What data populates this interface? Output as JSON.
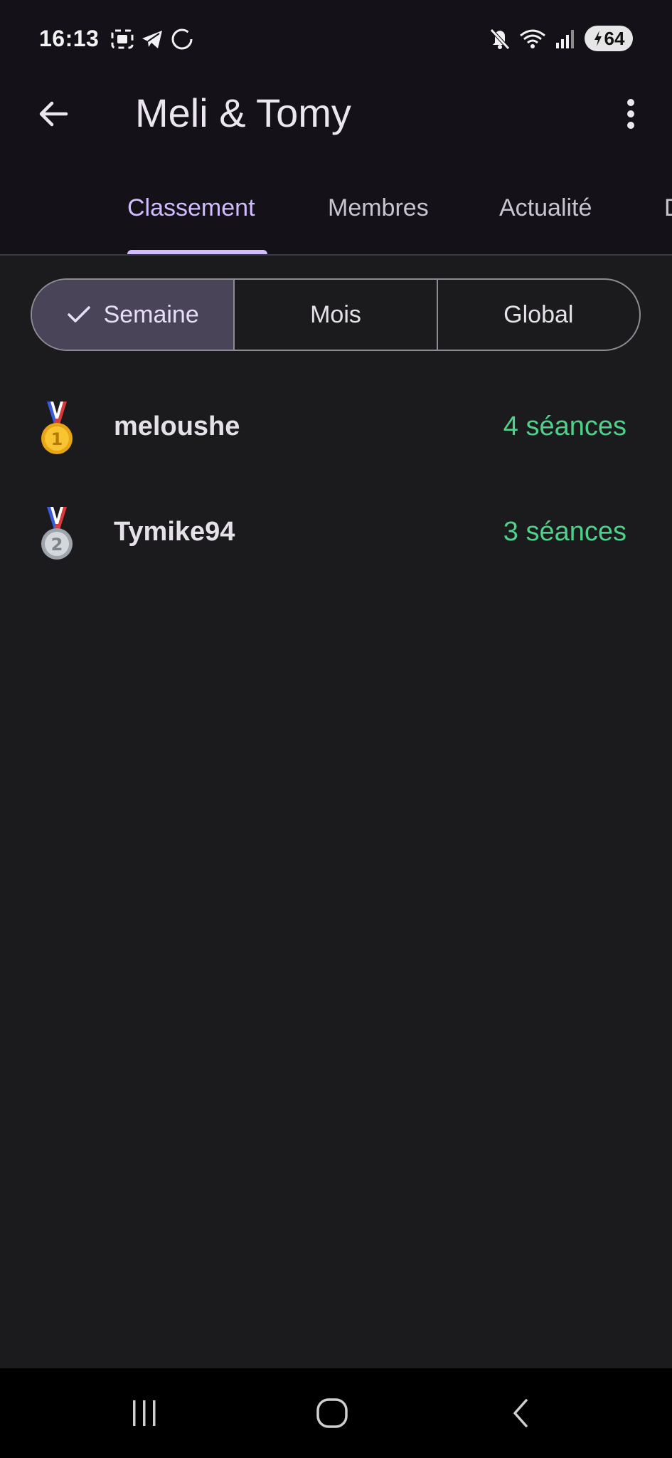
{
  "status_bar": {
    "time": "16:13",
    "battery": "64",
    "left_icons": [
      "screenshot-icon",
      "telegram-icon",
      "loading-circle-icon"
    ],
    "right_icons": [
      "mute-icon",
      "wifi-icon",
      "signal-icon"
    ]
  },
  "header": {
    "title": "Meli & Tomy"
  },
  "tabs": [
    {
      "label": "Classement",
      "active": true
    },
    {
      "label": "Membres",
      "active": false
    },
    {
      "label": "Actualité",
      "active": false
    },
    {
      "label": "D",
      "active": false
    }
  ],
  "period_filter": {
    "options": [
      "Semaine",
      "Mois",
      "Global"
    ],
    "selected": "Semaine"
  },
  "leaderboard": [
    {
      "rank": 1,
      "medal": "gold-medal-icon",
      "name": "meloushe",
      "sessions": "4 séances"
    },
    {
      "rank": 2,
      "medal": "silver-medal-icon",
      "name": "Tymike94",
      "sessions": "3 séances"
    }
  ],
  "colors": {
    "accent": "#d0bcff",
    "session_green": "#4fd18b",
    "background": "#1b1b1d",
    "top_bar": "#141218",
    "selected_segment": "#4a4458"
  }
}
